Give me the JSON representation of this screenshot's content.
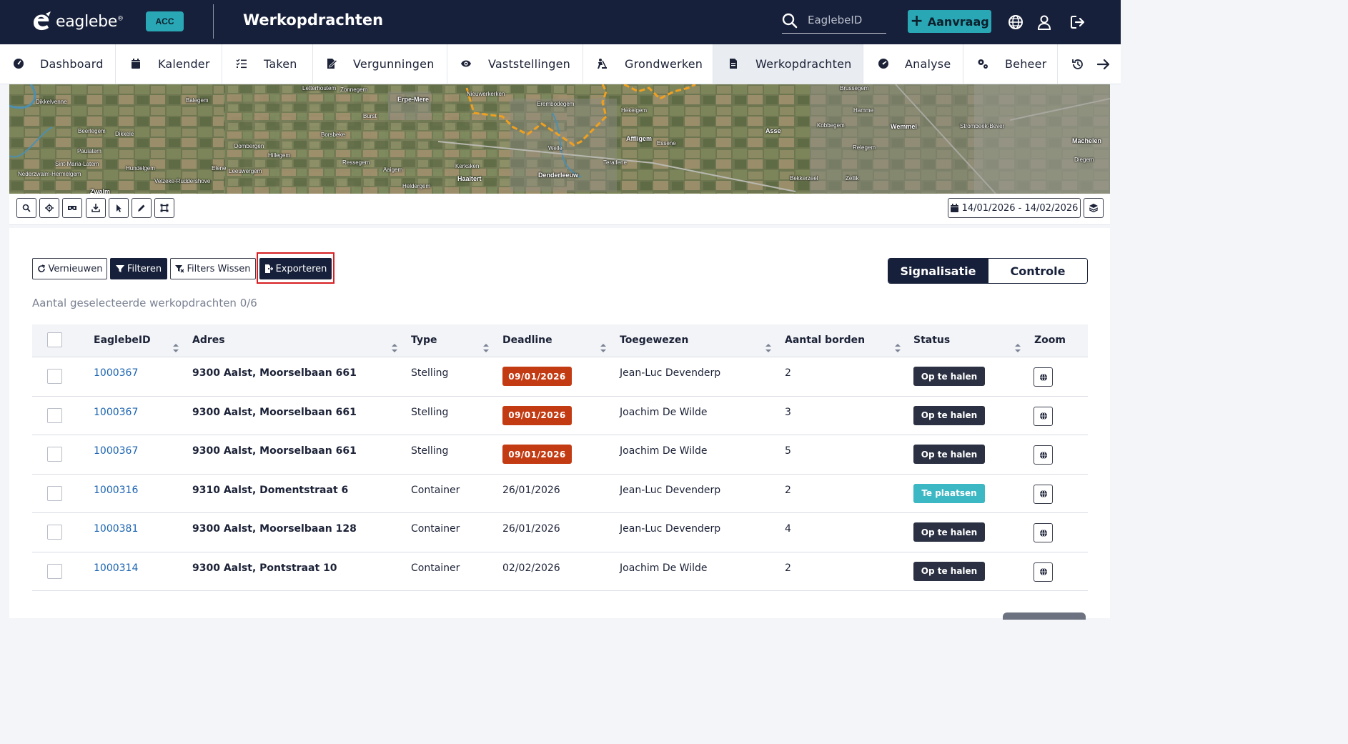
{
  "header": {
    "logo_text": "eaglebe",
    "logo_mark": "®",
    "env_badge": "ACC",
    "page_title": "Werkopdrachten",
    "search_placeholder": "EaglebeID",
    "new_button": "Aanvraag",
    "icons": [
      "search-icon",
      "plus-icon",
      "globe-icon",
      "user-icon",
      "logout-icon"
    ]
  },
  "nav": {
    "items": [
      {
        "label": "Dashboard",
        "icon": "dashboard-icon"
      },
      {
        "label": "Kalender",
        "icon": "calendar-icon"
      },
      {
        "label": "Taken",
        "icon": "task-list-icon"
      },
      {
        "label": "Vergunningen",
        "icon": "permit-icon"
      },
      {
        "label": "Vaststellingen",
        "icon": "eye-icon"
      },
      {
        "label": "Grondwerken",
        "icon": "digging-icon"
      },
      {
        "label": "Werkopdrachten",
        "icon": "document-icon",
        "active": true
      },
      {
        "label": "Analyse",
        "icon": "gauge-icon"
      },
      {
        "label": "Beheer",
        "icon": "gears-icon"
      }
    ],
    "tail_icons": [
      "history-icon",
      "arrow-right-icon"
    ]
  },
  "map": {
    "labels": [
      "Dikkelvenne",
      "Balegem",
      "Letterhoutem",
      "Zonnegem",
      "Erpe-Mere",
      "Nieuwerkerken",
      "Erembodegem",
      "Hekelgem",
      "Brussegem",
      "Hamme",
      "Asse",
      "Kobbegem",
      "Wemmel",
      "Strombeek-Bever",
      "Machelen",
      "Beerlegem",
      "Dikkele",
      "Borsbeke",
      "Burst",
      "Affligem",
      "Essene",
      "Relegem",
      "Diegem",
      "Paulatem",
      "Oombergen",
      "Hillegem",
      "Welle",
      "Teralfene",
      "Sint-Maria-Latem",
      "Hundelgem",
      "Elene",
      "Leeuwergem",
      "Ressegem",
      "Aaigem",
      "Kerksken",
      "Denderleeuw",
      "Bekkerzeel",
      "Zellik",
      "Nederzwalm-Hermelgem",
      "Velzeke-Ruddershove",
      "Heldergem",
      "Haaltert",
      "Zwalm"
    ]
  },
  "map_toolbar": {
    "tools": [
      "search-icon",
      "locate-icon",
      "street-view-icon",
      "download-icon",
      "pointer-icon",
      "pencil-icon",
      "select-area-icon"
    ],
    "date_range": "14/01/2026 - 14/02/2026",
    "layers_icon": "layers-icon"
  },
  "actions": {
    "refresh": "Vernieuwen",
    "filter": "Filteren",
    "clear_filters": "Filters Wissen",
    "export": "Exporteren"
  },
  "segment": {
    "options": [
      "Signalisatie",
      "Controle"
    ],
    "selected": "Signalisatie"
  },
  "selection_count": "Aantal geselecteerde werkopdrachten 0/6",
  "table": {
    "columns": [
      "EaglebeID",
      "Adres",
      "Type",
      "Deadline",
      "Toegewezen",
      "Aantal borden",
      "Status",
      "Zoom"
    ],
    "rows": [
      {
        "id": "1000367",
        "address": "9300 Aalst, Moorselbaan 661",
        "type": "Stelling",
        "deadline": "09/01/2026",
        "overdue": true,
        "assigned": "Jean-Luc Devenderp",
        "signs": "2",
        "status": "Op te halen"
      },
      {
        "id": "1000367",
        "address": "9300 Aalst, Moorselbaan 661",
        "type": "Stelling",
        "deadline": "09/01/2026",
        "overdue": true,
        "assigned": "Joachim De Wilde",
        "signs": "3",
        "status": "Op te halen"
      },
      {
        "id": "1000367",
        "address": "9300 Aalst, Moorselbaan 661",
        "type": "Stelling",
        "deadline": "09/01/2026",
        "overdue": true,
        "assigned": "Joachim De Wilde",
        "signs": "5",
        "status": "Op te halen"
      },
      {
        "id": "1000316",
        "address": "9310 Aalst, Domentstraat 6",
        "type": "Container",
        "deadline": "26/01/2026",
        "overdue": false,
        "assigned": "Jean-Luc Devenderp",
        "signs": "2",
        "status": "Te plaatsen"
      },
      {
        "id": "1000381",
        "address": "9300 Aalst, Moorselbaan 128",
        "type": "Container",
        "deadline": "26/01/2026",
        "overdue": false,
        "assigned": "Jean-Luc Devenderp",
        "signs": "4",
        "status": "Op te halen"
      },
      {
        "id": "1000314",
        "address": "9300 Aalst, Pontstraat 10",
        "type": "Container",
        "deadline": "02/02/2026",
        "overdue": false,
        "assigned": "Joachim De Wilde",
        "signs": "2",
        "status": "Op te halen"
      }
    ]
  },
  "colors": {
    "header_bg": "#17203a",
    "accent": "#2aa7b5",
    "overdue": "#c33b12",
    "status_pickup": "#2b3142",
    "status_place": "#3cb7c4",
    "link": "#1a63b0",
    "highlight": "#d71e22"
  }
}
